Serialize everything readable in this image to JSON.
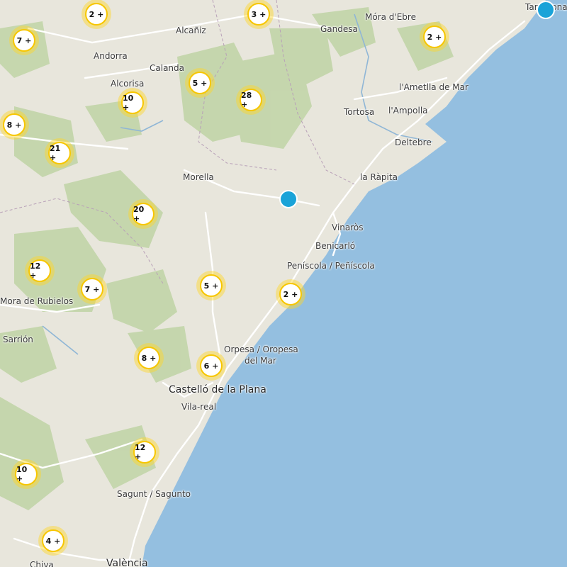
{
  "map": {
    "colors": {
      "sea": "#94bfe0",
      "land": "#e8e6dc",
      "forest": "#b9cf9f",
      "road": "#ffffff",
      "river": "#8fb6d6",
      "cluster_ring": "#f7c600",
      "pin": "#1aa3d8"
    },
    "places": [
      {
        "id": "alcaniz",
        "name": "Alcañiz"
      },
      {
        "id": "gandesa",
        "name": "Gandesa"
      },
      {
        "id": "mora",
        "name": "Móra d'Ebre"
      },
      {
        "id": "andorra",
        "name": "Andorra"
      },
      {
        "id": "calanda",
        "name": "Calanda"
      },
      {
        "id": "alcorisa",
        "name": "Alcorisa"
      },
      {
        "id": "ametlla",
        "name": "l'Ametlla de Mar"
      },
      {
        "id": "tortosa",
        "name": "Tortosa"
      },
      {
        "id": "ampolla",
        "name": "l'Ampolla"
      },
      {
        "id": "deltebre",
        "name": "Deltebre"
      },
      {
        "id": "rapita",
        "name": "la Ràpita"
      },
      {
        "id": "morella",
        "name": "Morella"
      },
      {
        "id": "vinaros",
        "name": "Vinaròs"
      },
      {
        "id": "benicarlo",
        "name": "Benicarló"
      },
      {
        "id": "peniscola",
        "name": "Peníscola / Peñíscola"
      },
      {
        "id": "mora_rubielos",
        "name": "Mora de Rubielos"
      },
      {
        "id": "sarrion",
        "name": "Sarrión"
      },
      {
        "id": "oropesa1",
        "name": "Orpesa / Oropesa"
      },
      {
        "id": "oropesa2",
        "name": "del Mar"
      },
      {
        "id": "castello",
        "name": "Castelló de la Plana"
      },
      {
        "id": "vilareal",
        "name": "Vila-real"
      },
      {
        "id": "sagunt",
        "name": "Sagunt / Sagunto"
      },
      {
        "id": "chiva",
        "name": "Chiva"
      },
      {
        "id": "valencia",
        "name": "València"
      },
      {
        "id": "tarragona",
        "name": "Tarragona"
      }
    ],
    "clusters": [
      {
        "id": "c1",
        "label": "2 +"
      },
      {
        "id": "c2",
        "label": "3 +"
      },
      {
        "id": "c3",
        "label": "7 +"
      },
      {
        "id": "c4",
        "label": "2 +"
      },
      {
        "id": "c5",
        "label": "5 +"
      },
      {
        "id": "c6",
        "label": "10 +"
      },
      {
        "id": "c7",
        "label": "28 +"
      },
      {
        "id": "c8",
        "label": "8 +"
      },
      {
        "id": "c9",
        "label": "21 +"
      },
      {
        "id": "c10",
        "label": "20 +"
      },
      {
        "id": "c11",
        "label": "12 +"
      },
      {
        "id": "c12",
        "label": "7 +"
      },
      {
        "id": "c13",
        "label": "5 +"
      },
      {
        "id": "c14",
        "label": "2 +"
      },
      {
        "id": "c15",
        "label": "8 +"
      },
      {
        "id": "c16",
        "label": "6 +"
      },
      {
        "id": "c17",
        "label": "12 +"
      },
      {
        "id": "c18",
        "label": "10 +"
      },
      {
        "id": "c19",
        "label": "4 +"
      }
    ],
    "pins": [
      {
        "id": "p1",
        "type": "single-marker"
      },
      {
        "id": "p2",
        "type": "single-marker"
      }
    ]
  }
}
